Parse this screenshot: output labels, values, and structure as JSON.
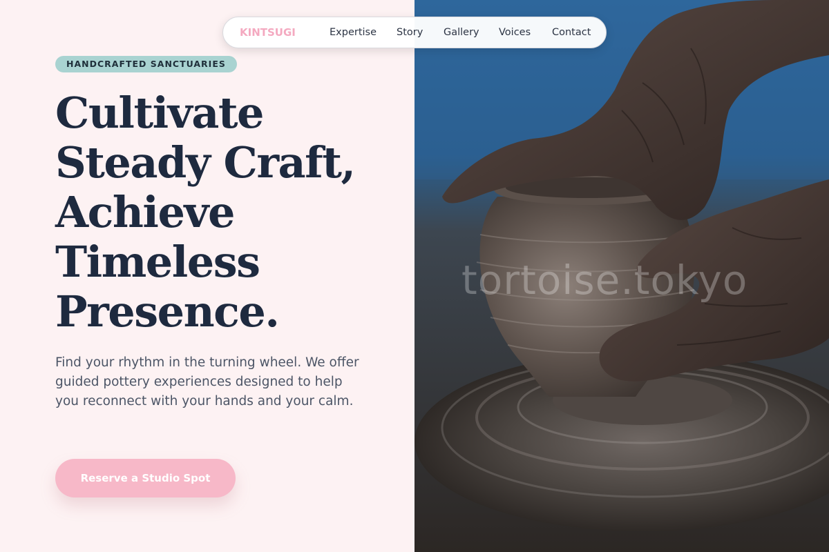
{
  "nav": {
    "brand": "KINTSUGI",
    "links": [
      "Expertise",
      "Story",
      "Gallery",
      "Voices",
      "Contact"
    ]
  },
  "hero": {
    "badge": "HANDCRAFTED SANCTUARIES",
    "headline_lines": [
      "Cultivate",
      "Steady Craft,",
      "Achieve",
      "Timeless",
      "Presence."
    ],
    "description": "Find your rhythm in the turning wheel. We offer guided pottery experiences designed to help you reconnect with your hands and your calm.",
    "cta_label": "Reserve a Studio Spot"
  },
  "image": {
    "subject": "hands shaping a clay pot on a pottery wheel",
    "watermark": "tortoise.tokyo"
  },
  "colors": {
    "page_background": "#fdf2f3",
    "brand_pink": "#f4a9c0",
    "cta_pink": "#f7b8c8",
    "badge_teal": "#a9d3d1",
    "headline_navy": "#1e2a3f",
    "body_gray": "#4c5566"
  }
}
